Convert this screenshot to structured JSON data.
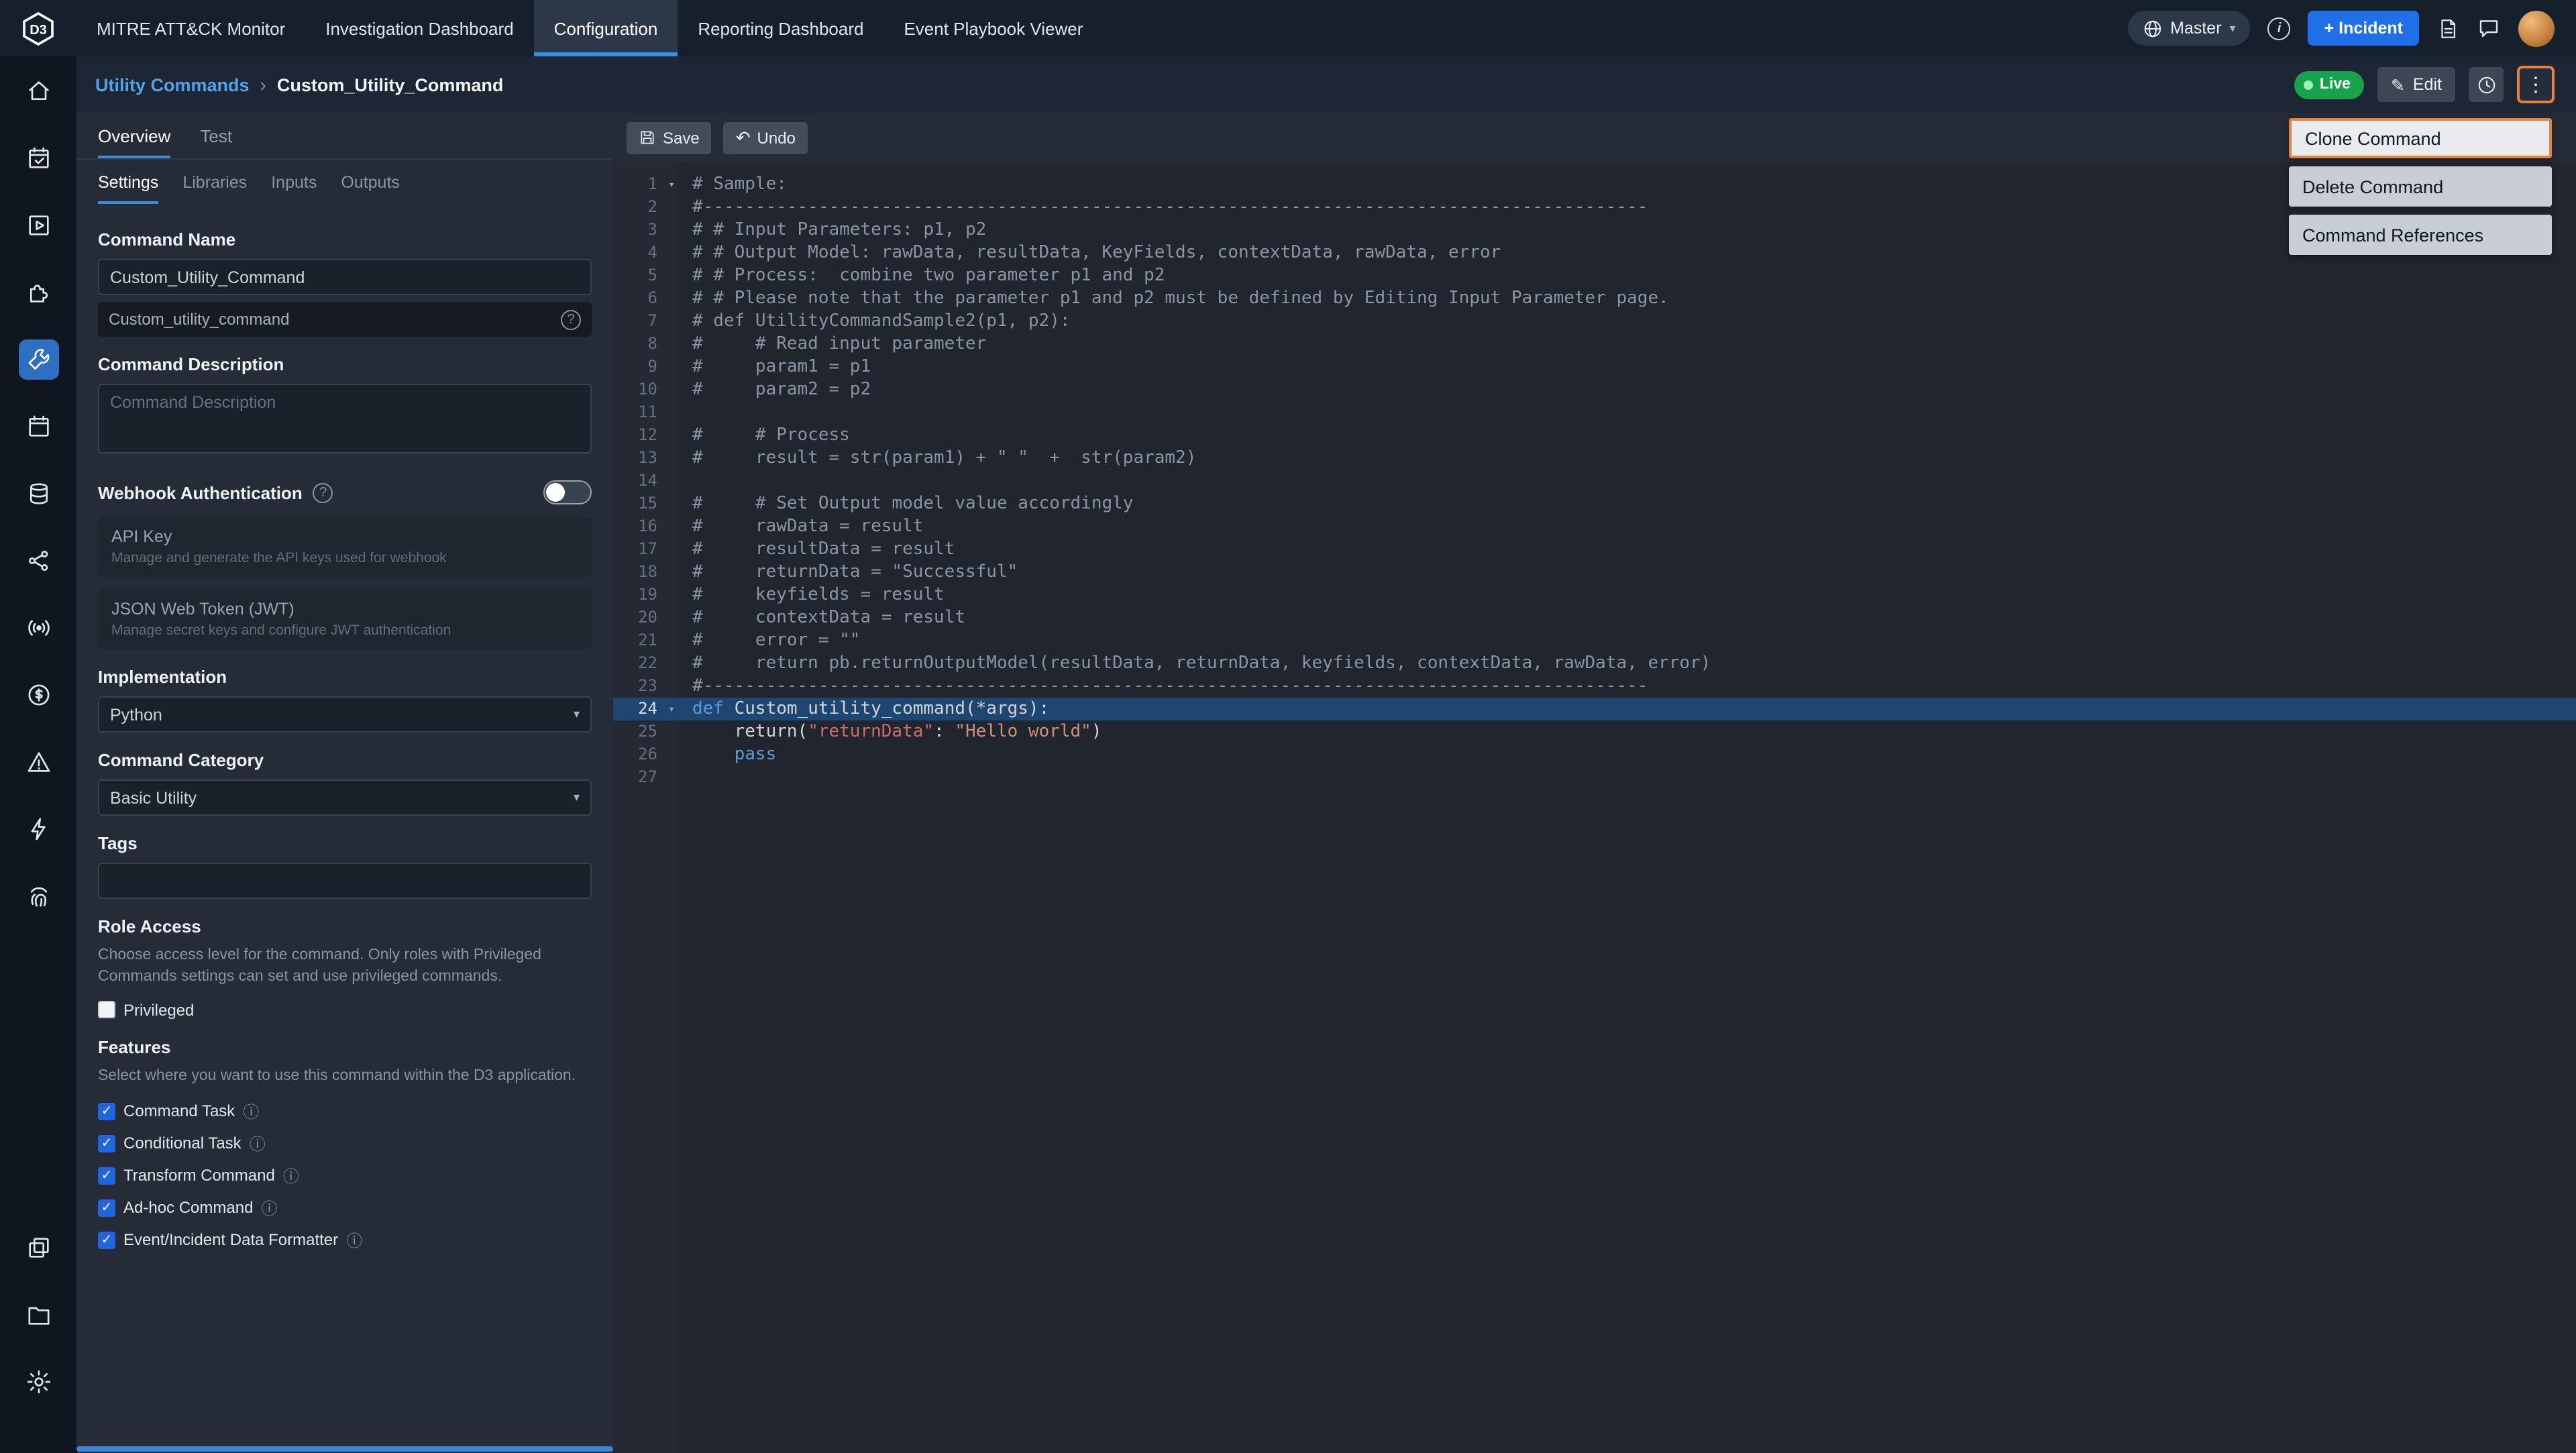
{
  "app": {
    "logo_text": "D3"
  },
  "colors": {
    "accent_blue": "#3f8cdc",
    "accent_orange": "#e8813c",
    "live_green": "#18a24b",
    "incident_blue": "#1e6fe8",
    "active_icon_blue": "#2f6fc1",
    "panel_scrollbar_blue": "#3b82d8"
  },
  "topnav": {
    "items": [
      {
        "label": "MITRE ATT&CK Monitor",
        "active": false
      },
      {
        "label": "Investigation Dashboard",
        "active": false
      },
      {
        "label": "Configuration",
        "active": true
      },
      {
        "label": "Reporting Dashboard",
        "active": false
      },
      {
        "label": "Event Playbook Viewer",
        "active": false
      }
    ],
    "master_label": "Master",
    "incident_button": "+ Incident"
  },
  "sidebar_rail": {
    "active": "utility-commands",
    "icons": [
      "home",
      "event-monitor",
      "investigation",
      "integrations",
      "utility-commands",
      "calendar",
      "data-store",
      "connections",
      "signal",
      "asset-globe",
      "alerts",
      "automation",
      "fingerprint",
      "windows",
      "files",
      "settings"
    ]
  },
  "breadcrumb": {
    "parent": "Utility Commands",
    "separator": "›",
    "current": "Custom_Utility_Command"
  },
  "header_actions": {
    "live_label": "Live",
    "edit_label": "Edit"
  },
  "menu": {
    "items": [
      {
        "label": "Clone Command",
        "highlighted": true
      },
      {
        "label": "Delete Command",
        "highlighted": false
      },
      {
        "label": "Command References",
        "highlighted": false
      }
    ]
  },
  "panel": {
    "tabs": [
      {
        "label": "Overview",
        "active": true
      },
      {
        "label": "Test",
        "active": false
      }
    ],
    "subtabs": [
      {
        "label": "Settings",
        "active": true
      },
      {
        "label": "Libraries",
        "active": false
      },
      {
        "label": "Inputs",
        "active": false
      },
      {
        "label": "Outputs",
        "active": false
      }
    ],
    "command_name": {
      "label": "Command Name",
      "value": "Custom_Utility_Command",
      "internal": "Custom_utility_command"
    },
    "command_description": {
      "label": "Command Description",
      "placeholder": "Command Description",
      "value": ""
    },
    "webhook": {
      "label": "Webhook Authentication",
      "toggle_on": false,
      "api_key": {
        "title": "API Key",
        "desc": "Manage and generate the API keys used for webhook"
      },
      "jwt": {
        "title": "JSON Web Token (JWT)",
        "desc": "Manage secret keys and configure JWT authentication"
      }
    },
    "implementation": {
      "label": "Implementation",
      "value": "Python"
    },
    "category": {
      "label": "Command Category",
      "value": "Basic Utility"
    },
    "tags": {
      "label": "Tags",
      "value": ""
    },
    "role_access": {
      "label": "Role Access",
      "desc": "Choose access level for the command. Only roles with Privileged Commands settings can set and use privileged commands.",
      "checkbox_label": "Privileged",
      "checked": false
    },
    "features": {
      "label": "Features",
      "desc": "Select where you want to use this command within the D3 application.",
      "items": [
        {
          "label": "Command Task",
          "checked": true
        },
        {
          "label": "Conditional Task",
          "checked": true
        },
        {
          "label": "Transform Command",
          "checked": true
        },
        {
          "label": "Ad-hoc Command",
          "checked": true
        },
        {
          "label": "Event/Incident Data Formatter",
          "checked": true
        }
      ]
    }
  },
  "editor": {
    "toolbar": {
      "save_label": "Save",
      "undo_label": "Undo"
    },
    "colors": {
      "comment": "#8a94a6",
      "keyword": "#569cd6",
      "string": "#ce9178",
      "str_red": "#d16969",
      "plain": "#d4d4d4"
    },
    "lines": [
      {
        "n": 1,
        "fold": true,
        "t": [
          {
            "s": "# Sample:",
            "c": "comment"
          }
        ]
      },
      {
        "n": 2,
        "t": [
          {
            "s": "#------------------------------------------------------------------------------------------",
            "c": "comment"
          }
        ]
      },
      {
        "n": 3,
        "t": [
          {
            "s": "# # Input Parameters: p1, p2",
            "c": "comment"
          }
        ]
      },
      {
        "n": 4,
        "t": [
          {
            "s": "# # Output Model: rawData, resultData, KeyFields, contextData, rawData, error",
            "c": "comment"
          }
        ]
      },
      {
        "n": 5,
        "t": [
          {
            "s": "# # Process:  combine two parameter p1 and p2",
            "c": "comment"
          }
        ]
      },
      {
        "n": 6,
        "t": [
          {
            "s": "# # Please note that the parameter p1 and p2 must be defined by Editing Input Parameter page.",
            "c": "comment"
          }
        ]
      },
      {
        "n": 7,
        "t": [
          {
            "s": "# def UtilityCommandSample2(p1, p2):",
            "c": "comment"
          }
        ]
      },
      {
        "n": 8,
        "t": [
          {
            "s": "#     # Read input parameter",
            "c": "comment"
          }
        ]
      },
      {
        "n": 9,
        "t": [
          {
            "s": "#     param1 = p1",
            "c": "comment"
          }
        ]
      },
      {
        "n": 10,
        "t": [
          {
            "s": "#     param2 = p2",
            "c": "comment"
          }
        ]
      },
      {
        "n": 11,
        "t": []
      },
      {
        "n": 12,
        "t": [
          {
            "s": "#     # Process",
            "c": "comment"
          }
        ]
      },
      {
        "n": 13,
        "t": [
          {
            "s": "#     result = str(param1) + \" \"  +  str(param2)",
            "c": "comment"
          }
        ]
      },
      {
        "n": 14,
        "t": []
      },
      {
        "n": 15,
        "t": [
          {
            "s": "#     # Set Output model value accordingly",
            "c": "comment"
          }
        ]
      },
      {
        "n": 16,
        "t": [
          {
            "s": "#     rawData = result",
            "c": "comment"
          }
        ]
      },
      {
        "n": 17,
        "t": [
          {
            "s": "#     resultData = result",
            "c": "comment"
          }
        ]
      },
      {
        "n": 18,
        "t": [
          {
            "s": "#     returnData = \"Successful\"",
            "c": "comment"
          }
        ]
      },
      {
        "n": 19,
        "t": [
          {
            "s": "#     keyfields = result",
            "c": "comment"
          }
        ]
      },
      {
        "n": 20,
        "t": [
          {
            "s": "#     contextData = result",
            "c": "comment"
          }
        ]
      },
      {
        "n": 21,
        "t": [
          {
            "s": "#     error = \"\"",
            "c": "comment"
          }
        ]
      },
      {
        "n": 22,
        "t": [
          {
            "s": "#     return pb.returnOutputModel(resultData, returnData, keyfields, contextData, rawData, error)",
            "c": "comment"
          }
        ]
      },
      {
        "n": 23,
        "t": [
          {
            "s": "#------------------------------------------------------------------------------------------",
            "c": "comment"
          }
        ]
      },
      {
        "n": 24,
        "hl": true,
        "fold": true,
        "t": [
          {
            "s": "def",
            "c": "keyword"
          },
          {
            "s": " Custom_utility_command(*args):",
            "c": "plain"
          }
        ]
      },
      {
        "n": 25,
        "t": [
          {
            "s": "    return(",
            "c": "plain"
          },
          {
            "s": "\"returnData\"",
            "c": "str_red"
          },
          {
            "s": ": ",
            "c": "plain"
          },
          {
            "s": "\"Hello world\"",
            "c": "string"
          },
          {
            "s": ")",
            "c": "plain"
          }
        ]
      },
      {
        "n": 26,
        "t": [
          {
            "s": "    ",
            "c": "plain"
          },
          {
            "s": "pass",
            "c": "keyword"
          }
        ]
      },
      {
        "n": 27,
        "t": []
      }
    ]
  }
}
